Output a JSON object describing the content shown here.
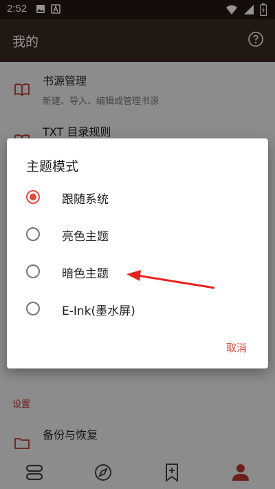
{
  "status_bar": {
    "time": "2:52",
    "icons": [
      "image-icon",
      "a-badge-icon",
      "wifi-icon",
      "signal-icon",
      "battery-icon"
    ]
  },
  "app_bar": {
    "title": "我的",
    "help_icon": "help-circle-icon"
  },
  "list": [
    {
      "title": "书源管理",
      "subtitle": "新建、导入、编辑或管理书源",
      "icon": "book-open-icon"
    },
    {
      "title": "TXT 目录规则",
      "icon": "book-open-icon"
    }
  ],
  "settings_section": {
    "label": "设置",
    "items": [
      {
        "title": "备份与恢复",
        "icon": "folder-icon"
      }
    ]
  },
  "dialog": {
    "title": "主题模式",
    "options": [
      {
        "label": "跟随系统",
        "selected": true
      },
      {
        "label": "亮色主题",
        "selected": false
      },
      {
        "label": "暗色主题",
        "selected": false
      },
      {
        "label": "E-Ink(墨水屏)",
        "selected": false
      }
    ],
    "cancel_label": "取消"
  },
  "bottom_nav": [
    {
      "name": "bookshelf",
      "icon": "bookshelf-icon",
      "active": false
    },
    {
      "name": "discover",
      "icon": "compass-icon",
      "active": false
    },
    {
      "name": "rss",
      "icon": "bookmark-plus-icon",
      "active": false
    },
    {
      "name": "my",
      "icon": "person-icon",
      "active": true
    }
  ],
  "colors": {
    "app_bar": "#3b2a21",
    "status_bar": "#241712",
    "accent": "#e04a3f",
    "annotation_arrow": "#e8231f"
  }
}
